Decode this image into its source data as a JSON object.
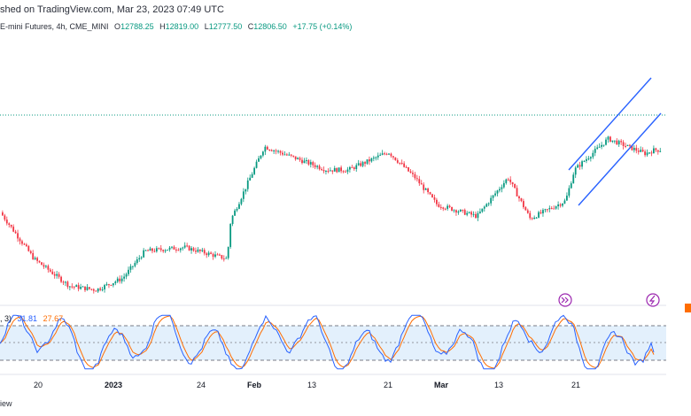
{
  "header": {
    "publish_text": "shed on TradingView.com, Mar 23, 2023 07:49 UTC",
    "symbol": "E-mini Futures, 4h, CME_MINI",
    "open_label": "O",
    "open": "12788.25",
    "high_label": "H",
    "high": "12819.00",
    "low_label": "L",
    "low": "12777.50",
    "close_label": "C",
    "close": "12806.50",
    "change": "+17.75 (+0.14%)"
  },
  "oscillator": {
    "params_tail": ", 3)",
    "k_value": "31.81",
    "d_value": "27.67"
  },
  "footer": {
    "text": "iew"
  },
  "colors": {
    "up": "#089981",
    "down": "#f23645",
    "channel": "#2962ff",
    "k_line": "#2962ff",
    "d_line": "#ff6d00",
    "band_fill": "#e3f0fc",
    "last_price_line": "#089981",
    "replay_icon": "#9c27b0"
  },
  "icons": [
    "replay-icon",
    "flash-icon"
  ],
  "chart_data": [
    {
      "type": "candlestick",
      "interval": "4h",
      "x_ticks": [
        "20",
        "2023",
        "24",
        "Feb",
        "13",
        "21",
        "Mar",
        "13",
        "21"
      ],
      "x_tick_bold": [
        "2023",
        "Feb",
        "Mar"
      ],
      "price_series_approx": [
        [
          "late Dec",
          12000
        ],
        [
          "Dec 20",
          11400
        ],
        [
          "Dec 28",
          11050
        ],
        [
          "Jan 2",
          11000
        ],
        [
          "Jan 6",
          11150
        ],
        [
          "Jan 12",
          11500
        ],
        [
          "Jan 18",
          11550
        ],
        [
          "Jan 19",
          11400
        ],
        [
          "Jan 25",
          11900
        ],
        [
          "Feb 2",
          12850
        ],
        [
          "Feb 6",
          12550
        ],
        [
          "Feb 13",
          12550
        ],
        [
          "Feb 15",
          12780
        ],
        [
          "Feb 17",
          12450
        ],
        [
          "Feb 24",
          12100
        ],
        [
          "Mar 1",
          11950
        ],
        [
          "Mar 6",
          12450
        ],
        [
          "Mar 10",
          11920
        ],
        [
          "Mar 13",
          12150
        ],
        [
          "Mar 15",
          12550
        ],
        [
          "Mar 21",
          12950
        ],
        [
          "Mar 22",
          12760
        ],
        [
          "Mar 23",
          12806.5
        ]
      ],
      "last_close": 12806.5,
      "annotations": [
        "ascending channel (two parallel trend lines)"
      ]
    },
    {
      "type": "line",
      "indicator": "stochastic",
      "series": [
        {
          "value": 31.81
        },
        {
          "value": 27.67
        }
      ],
      "ylim": [
        0,
        100
      ],
      "bands": [
        20,
        50,
        80
      ],
      "grid": false
    }
  ]
}
